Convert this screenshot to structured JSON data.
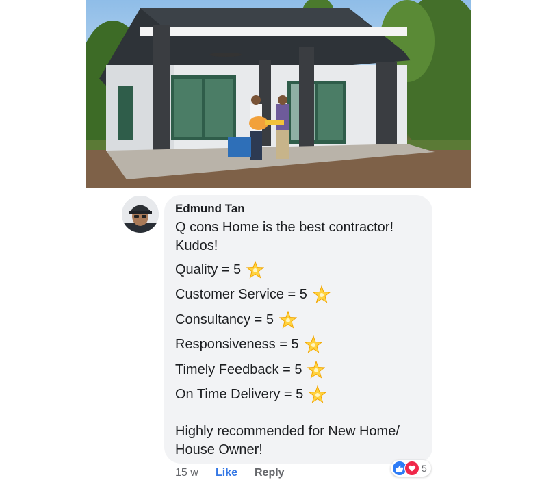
{
  "comment": {
    "author": "Edmund Tan",
    "text_line1": "Q cons Home is the best contractor!",
    "text_line2": "Kudos!",
    "ratings": [
      {
        "label": "Quality = 5"
      },
      {
        "label": "Customer Service = 5"
      },
      {
        "label": "Consultancy = 5"
      },
      {
        "label": "Responsiveness = 5"
      },
      {
        "label": "Timely Feedback = 5"
      },
      {
        "label": "On Time Delivery = 5"
      }
    ],
    "closing_line1": "Highly recommended for New Home/",
    "closing_line2": "House Owner!"
  },
  "actions": {
    "timestamp": "15 w",
    "like_label": "Like",
    "reply_label": "Reply",
    "reaction_count": "5"
  },
  "icons": {
    "star": "glowing-star-icon",
    "like": "thumbs-up-icon",
    "love": "heart-icon"
  },
  "colors": {
    "bubble": "#f2f3f5",
    "like_link": "#3578e5",
    "like_reaction": "#2e7cf6",
    "love_reaction": "#f0284a"
  }
}
